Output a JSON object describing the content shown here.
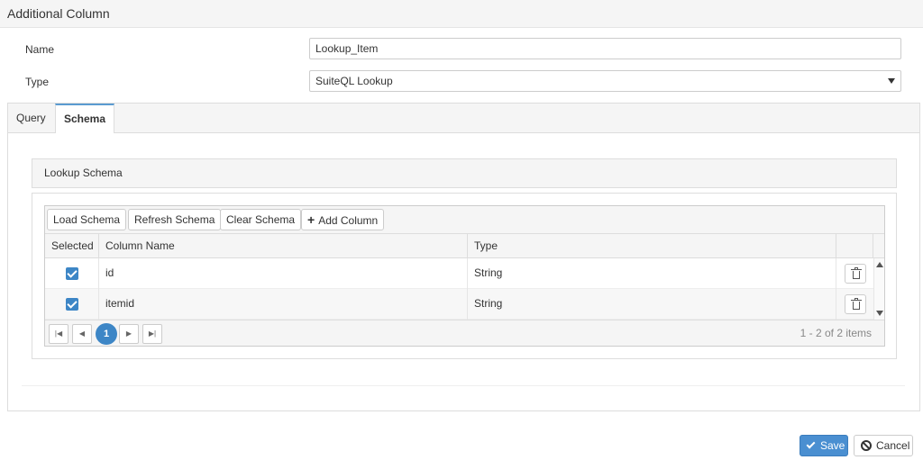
{
  "window": {
    "title": "Additional Column"
  },
  "form": {
    "name_label": "Name",
    "name_value": "Lookup_Item",
    "type_label": "Type",
    "type_value": "SuiteQL Lookup"
  },
  "tabs": [
    {
      "label": "Query",
      "active": false
    },
    {
      "label": "Schema",
      "active": true
    }
  ],
  "schema": {
    "section_title": "Lookup Schema",
    "toolbar": {
      "load_label": "Load Schema",
      "refresh_label": "Refresh Schema",
      "clear_label": "Clear Schema",
      "add_label": "Add Column"
    },
    "columns": [
      "Selected",
      "Column Name",
      "Type"
    ],
    "rows": [
      {
        "selected": true,
        "column_name": "id",
        "type": "String"
      },
      {
        "selected": true,
        "column_name": "itemid",
        "type": "String"
      }
    ],
    "pager": {
      "current_page": "1",
      "info": "1 - 2 of 2 items"
    }
  },
  "actions": {
    "save_label": "Save",
    "cancel_label": "Cancel"
  },
  "colors": {
    "accent": "#3d86c6",
    "save_button": "#4a8fd1"
  },
  "icons": [
    "plus-icon",
    "checkbox-checked-icon",
    "trash-icon",
    "scroll-up-icon",
    "scroll-down-icon",
    "first-page-icon",
    "prev-page-icon",
    "next-page-icon",
    "last-page-icon",
    "check-icon",
    "ban-icon",
    "chevron-down-icon"
  ]
}
